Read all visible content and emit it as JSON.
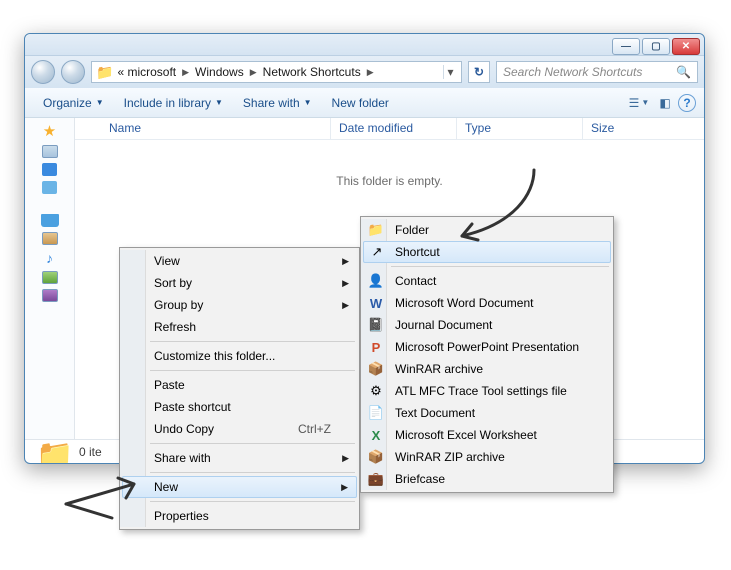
{
  "titlebar": {
    "minimize_glyph": "—",
    "maximize_glyph": "▢",
    "close_glyph": "✕"
  },
  "breadcrumb": {
    "segments": [
      "«  microsoft",
      "Windows",
      "Network Shortcuts"
    ]
  },
  "search": {
    "placeholder": "Search Network Shortcuts"
  },
  "toolbar": {
    "organize": "Organize",
    "include": "Include in library",
    "share": "Share with",
    "newfolder": "New folder"
  },
  "columns": {
    "name": "Name",
    "date": "Date modified",
    "type": "Type",
    "size": "Size"
  },
  "empty_message": "This folder is empty.",
  "status": {
    "items": "0 ite"
  },
  "context_main": {
    "view": "View",
    "sortby": "Sort by",
    "groupby": "Group by",
    "refresh": "Refresh",
    "customize": "Customize this folder...",
    "paste": "Paste",
    "paste_shortcut": "Paste shortcut",
    "undo_copy": "Undo Copy",
    "undo_copy_keys": "Ctrl+Z",
    "share_with": "Share with",
    "new": "New",
    "properties": "Properties"
  },
  "context_new": {
    "folder": "Folder",
    "shortcut": "Shortcut",
    "contact": "Contact",
    "word": "Microsoft Word Document",
    "journal": "Journal Document",
    "ppt": "Microsoft PowerPoint Presentation",
    "winrar": "WinRAR archive",
    "atl": "ATL MFC Trace Tool settings file",
    "text": "Text Document",
    "excel": "Microsoft Excel Worksheet",
    "winrarzip": "WinRAR ZIP archive",
    "briefcase": "Briefcase"
  }
}
